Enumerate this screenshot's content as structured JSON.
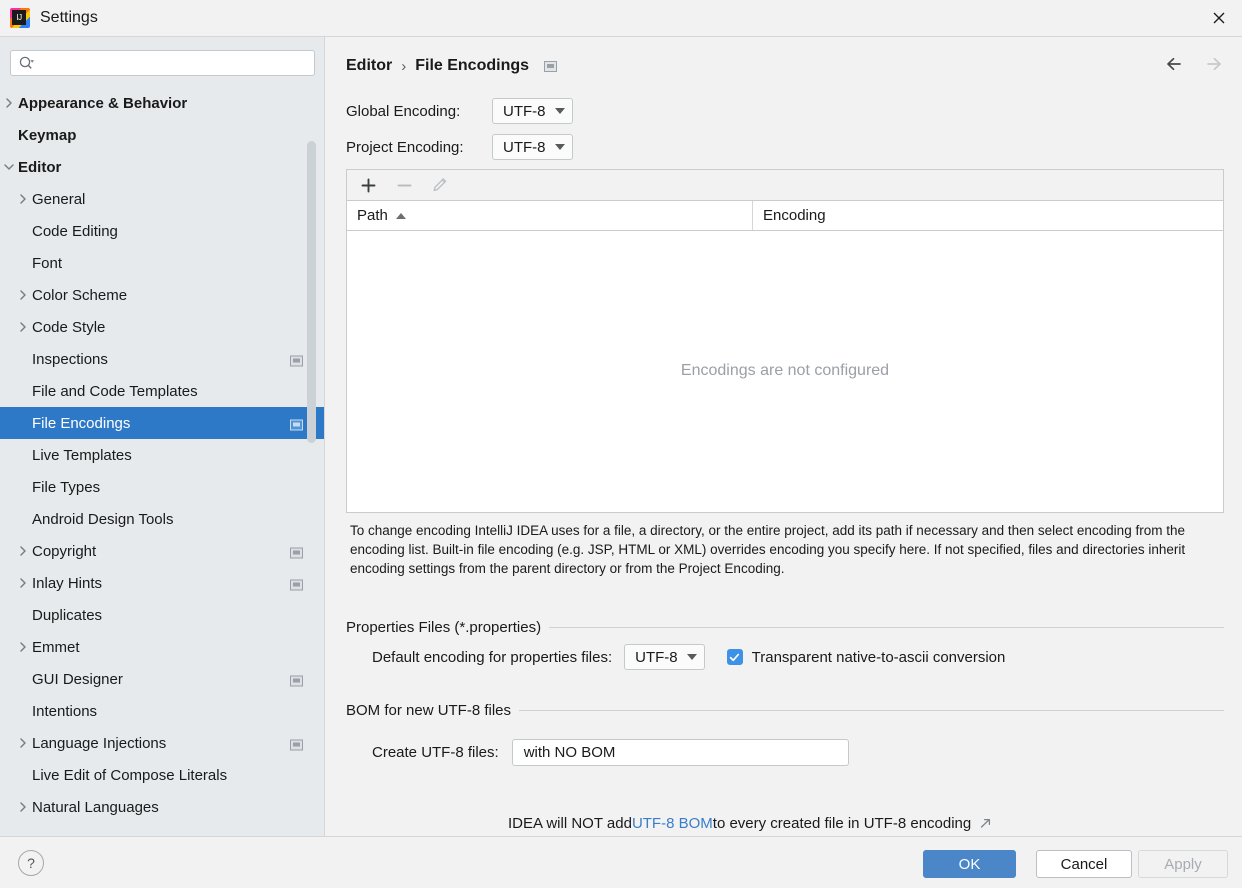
{
  "window": {
    "title": "Settings",
    "logo_icon": "intellij-idea-logo",
    "close_icon": "close-icon"
  },
  "sidebar": {
    "search": {
      "placeholder": "",
      "value": "",
      "icon": "search-icon"
    },
    "items": [
      {
        "label": "Appearance & Behavior",
        "twisty": "chevron-right",
        "bold": true,
        "indent": 12,
        "selected": false,
        "badge": false
      },
      {
        "label": "Keymap",
        "twisty": "none",
        "bold": true,
        "indent": 12,
        "selected": false,
        "badge": false
      },
      {
        "label": "Editor",
        "twisty": "chevron-down",
        "bold": true,
        "indent": 12,
        "selected": false,
        "badge": false
      },
      {
        "label": "General",
        "twisty": "chevron-right",
        "bold": false,
        "indent": 32,
        "selected": false,
        "badge": false
      },
      {
        "label": "Code Editing",
        "twisty": "none",
        "bold": false,
        "indent": 32,
        "selected": false,
        "badge": false
      },
      {
        "label": "Font",
        "twisty": "none",
        "bold": false,
        "indent": 32,
        "selected": false,
        "badge": false
      },
      {
        "label": "Color Scheme",
        "twisty": "chevron-right",
        "bold": false,
        "indent": 32,
        "selected": false,
        "badge": false
      },
      {
        "label": "Code Style",
        "twisty": "chevron-right",
        "bold": false,
        "indent": 32,
        "selected": false,
        "badge": false
      },
      {
        "label": "Inspections",
        "twisty": "none",
        "bold": false,
        "indent": 32,
        "selected": false,
        "badge": true
      },
      {
        "label": "File and Code Templates",
        "twisty": "none",
        "bold": false,
        "indent": 32,
        "selected": false,
        "badge": false
      },
      {
        "label": "File Encodings",
        "twisty": "none",
        "bold": false,
        "indent": 32,
        "selected": true,
        "badge": true
      },
      {
        "label": "Live Templates",
        "twisty": "none",
        "bold": false,
        "indent": 32,
        "selected": false,
        "badge": false
      },
      {
        "label": "File Types",
        "twisty": "none",
        "bold": false,
        "indent": 32,
        "selected": false,
        "badge": false
      },
      {
        "label": "Android Design Tools",
        "twisty": "none",
        "bold": false,
        "indent": 32,
        "selected": false,
        "badge": false
      },
      {
        "label": "Copyright",
        "twisty": "chevron-right",
        "bold": false,
        "indent": 32,
        "selected": false,
        "badge": true
      },
      {
        "label": "Inlay Hints",
        "twisty": "chevron-right",
        "bold": false,
        "indent": 32,
        "selected": false,
        "badge": true
      },
      {
        "label": "Duplicates",
        "twisty": "none",
        "bold": false,
        "indent": 32,
        "selected": false,
        "badge": false
      },
      {
        "label": "Emmet",
        "twisty": "chevron-right",
        "bold": false,
        "indent": 32,
        "selected": false,
        "badge": false
      },
      {
        "label": "GUI Designer",
        "twisty": "none",
        "bold": false,
        "indent": 32,
        "selected": false,
        "badge": true
      },
      {
        "label": "Intentions",
        "twisty": "none",
        "bold": false,
        "indent": 32,
        "selected": false,
        "badge": false
      },
      {
        "label": "Language Injections",
        "twisty": "chevron-right",
        "bold": false,
        "indent": 32,
        "selected": false,
        "badge": true
      },
      {
        "label": "Live Edit of Compose Literals",
        "twisty": "none",
        "bold": false,
        "indent": 32,
        "selected": false,
        "badge": false
      },
      {
        "label": "Natural Languages",
        "twisty": "chevron-right",
        "bold": false,
        "indent": 32,
        "selected": false,
        "badge": false
      }
    ]
  },
  "main": {
    "breadcrumb": {
      "root": "Editor",
      "separator": "›",
      "current": "File Encodings",
      "badge_icon": "project-settings-badge-icon"
    },
    "nav": {
      "back_icon": "arrow-left-icon",
      "back_enabled": true,
      "forward_icon": "arrow-right-icon",
      "forward_enabled": false
    },
    "global_encoding": {
      "label": "Global Encoding:",
      "value": "UTF-8"
    },
    "project_encoding": {
      "label": "Project Encoding:",
      "value": "UTF-8"
    },
    "table": {
      "toolbar": {
        "add_icon": "plus-icon",
        "add_enabled": true,
        "remove_icon": "minus-icon",
        "remove_enabled": false,
        "edit_icon": "pencil-icon",
        "edit_enabled": false
      },
      "columns": [
        "Path",
        "Encoding"
      ],
      "sort_column": "Path",
      "sort_direction": "ascending",
      "rows": [],
      "empty_message": "Encodings are not configured"
    },
    "help_text": "To change encoding IntelliJ IDEA uses for a file, a directory, or the entire project, add its path if necessary and then select encoding from the encoding list. Built-in file encoding (e.g. JSP, HTML or XML) overrides encoding you specify here. If not specified, files and directories inherit encoding settings from the parent directory or from the Project Encoding.",
    "properties_group": {
      "title": "Properties Files (*.properties)",
      "default_encoding_label": "Default encoding for properties files:",
      "default_encoding_value": "UTF-8",
      "transparent_checkbox_label": "Transparent native-to-ascii conversion",
      "transparent_checkbox_checked": true
    },
    "bom_group": {
      "title": "BOM for new UTF-8 files",
      "create_label": "Create UTF-8 files:",
      "create_value": "with NO BOM",
      "note_prefix": "IDEA will NOT add ",
      "note_link": "UTF-8 BOM",
      "note_suffix": " to every created file in UTF-8 encoding",
      "external_link_icon": "external-link-icon"
    }
  },
  "footer": {
    "help_icon": "question-mark-icon",
    "ok_label": "OK",
    "cancel_label": "Cancel",
    "apply_label": "Apply",
    "apply_enabled": false
  },
  "colors": {
    "accent_blue": "#2d79c7",
    "button_blue": "#4a86c8",
    "checkbox_blue": "#3d91e6",
    "link_blue": "#3a7dc9",
    "sidebar_bg": "#e6eaed",
    "panel_bg": "#f2f2f2",
    "muted_text": "#9aa0a6"
  }
}
